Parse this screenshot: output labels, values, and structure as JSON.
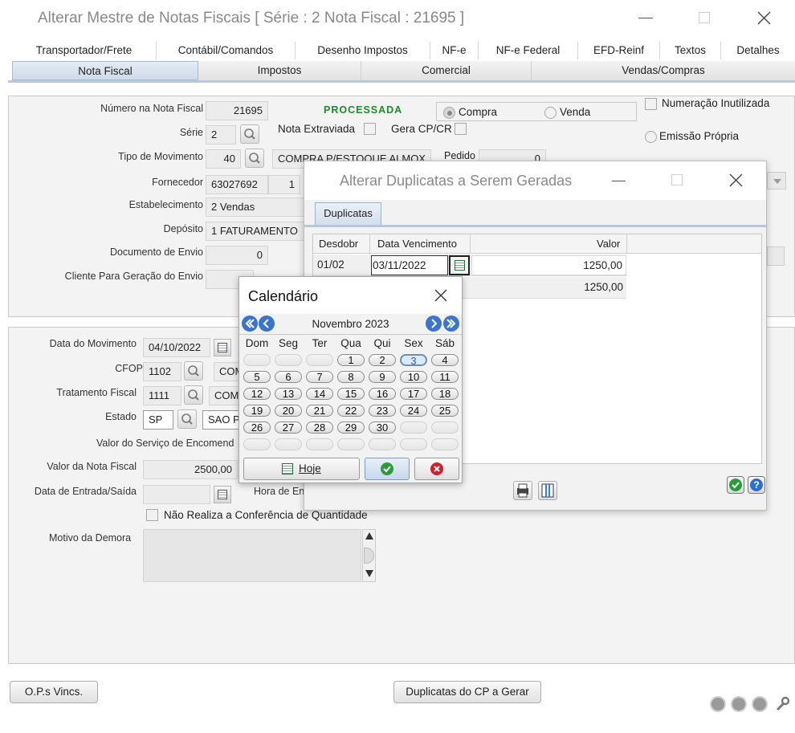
{
  "window": {
    "title": "Alterar Mestre de Notas Fiscais [ Série : 2   Nota Fiscal : 21695 ]"
  },
  "tabs_top": [
    "Transportador/Frete",
    "Contábil/Comandos",
    "Desenho Impostos",
    "NF-e",
    "NF-e Federal",
    "EFD-Reinf",
    "Textos",
    "Detalhes"
  ],
  "tabs_bottom": [
    "Nota Fiscal",
    "Impostos",
    "Comercial",
    "Vendas/Compras"
  ],
  "form": {
    "numero_label": "Número na Nota Fiscal",
    "numero_value": "21695",
    "status": "PROCESSADA",
    "compra_label": "Compra",
    "venda_label": "Venda",
    "numeracao_label": "Numeração Inutilizada",
    "emissao_label": "Emissão Própria",
    "serie_label": "Série",
    "serie_value": "2",
    "nota_extraviada_label": "Nota Extraviada",
    "gera_cpcr_label": "Gera CP/CR",
    "tipo_mov_label": "Tipo de Movimento",
    "tipo_mov_code": "40",
    "tipo_mov_desc": "COMPRA P/ESTOQUE ALMOX",
    "pedido_label": "Pedido",
    "pedido_value": "0",
    "fornecedor_label": "Fornecedor",
    "fornecedor_code": "63027692",
    "fornecedor_num": "1",
    "estabelecimento_label": "Estabelecimento",
    "estabelecimento_value": "2 Vendas",
    "deposito_label": "Depósito",
    "deposito_value": "1 FATURAMENTO",
    "doc_envio_label": "Documento de Envio",
    "doc_envio_value": "0",
    "cliente_label": "Cliente Para Geração do Envio",
    "data_mov_label": "Data do Movimento",
    "data_mov_value": "04/10/2022",
    "cfop_label": "CFOP",
    "cfop_value": "1102",
    "cfop_desc": "COM",
    "trat_label": "Tratamento Fiscal",
    "trat_value": "1111",
    "trat_desc": "COM",
    "estado_label": "Estado",
    "estado_value": "SP",
    "estado_desc": "SAO P",
    "valor_servico_label": "Valor do Serviço de Encomend",
    "valor_nf_label": "Valor da Nota Fiscal",
    "valor_nf_value": "2500,00",
    "data_entrada_label": "Data de Entrada/Saída",
    "hora_label": "Hora de En",
    "nao_realiza_label": "Não Realiza a Conferência de Quantidade",
    "motivo_label": "Motivo da Demora"
  },
  "footer": {
    "ops_button": "O.P.s Vincs.",
    "duplicatas_button": "Duplicatas do CP a Gerar"
  },
  "dup_dialog": {
    "title": "Alterar Duplicatas a Serem Geradas",
    "tab": "Duplicatas",
    "columns": [
      "Desdobr",
      "Data Vencimento",
      "Valor"
    ],
    "rows": [
      {
        "desdobr": "01/02",
        "data": "03/11/2022",
        "valor": "1250,00"
      },
      {
        "desdobr": "",
        "data": "",
        "valor": "1250,00"
      }
    ]
  },
  "calendar": {
    "title": "Calendário",
    "month": "Novembro 2023",
    "weekdays": [
      "Dom",
      "Seg",
      "Ter",
      "Qua",
      "Qui",
      "Sex",
      "Sáb"
    ],
    "weeks": [
      [
        "",
        "",
        "",
        "1",
        "2",
        "3",
        "4"
      ],
      [
        "5",
        "6",
        "7",
        "8",
        "9",
        "10",
        "11"
      ],
      [
        "12",
        "13",
        "14",
        "15",
        "16",
        "17",
        "18"
      ],
      [
        "19",
        "20",
        "21",
        "22",
        "23",
        "24",
        "25"
      ],
      [
        "26",
        "27",
        "28",
        "29",
        "30",
        "",
        ""
      ],
      [
        "",
        "",
        "",
        "",
        "",
        "",
        ""
      ]
    ],
    "selected_day": "3",
    "today_button": "Hoje",
    "colors": {
      "selected": "#3c5fb0",
      "ok": "#2a9c3c",
      "cancel": "#d0212b"
    }
  }
}
